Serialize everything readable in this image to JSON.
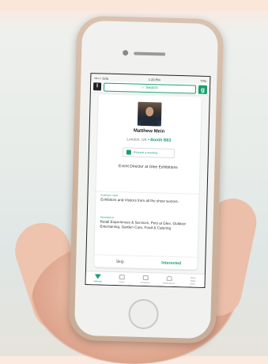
{
  "status": {
    "carrier": "•••○○ Grla",
    "time": "1:20 PM",
    "battery": "77%"
  },
  "header": {
    "search_placeholder": "Search",
    "logo_left": "I",
    "logo_right": "g"
  },
  "profile": {
    "name": "Matthew Mein",
    "location": "London, UK",
    "booth": "• Booth B83",
    "meeting_label": "Request a meeting",
    "role": "Event Director at Glee Exhibitions"
  },
  "looking_for": {
    "label": "looking to meet",
    "text": "Exhibitors and Visitors from all the show sectors."
  },
  "interested_in": {
    "label": "Interested in",
    "text": "Retail Experiences & Services, Pets at Glee, Outdoor Entertaining, Garden Care, Food & Catering"
  },
  "actions": {
    "skip": "Skip",
    "interested": "Interested"
  },
  "tabs": [
    {
      "label": "Network",
      "icon": "network-icon"
    },
    {
      "label": "Chats",
      "icon": "chat-icon"
    },
    {
      "label": "Schedule",
      "icon": "calendar-icon"
    },
    {
      "label": "Notifications",
      "icon": "bell-icon"
    },
    {
      "label": "More",
      "icon": "menu-icon"
    }
  ],
  "colors": {
    "accent": "#1a9f6e"
  }
}
